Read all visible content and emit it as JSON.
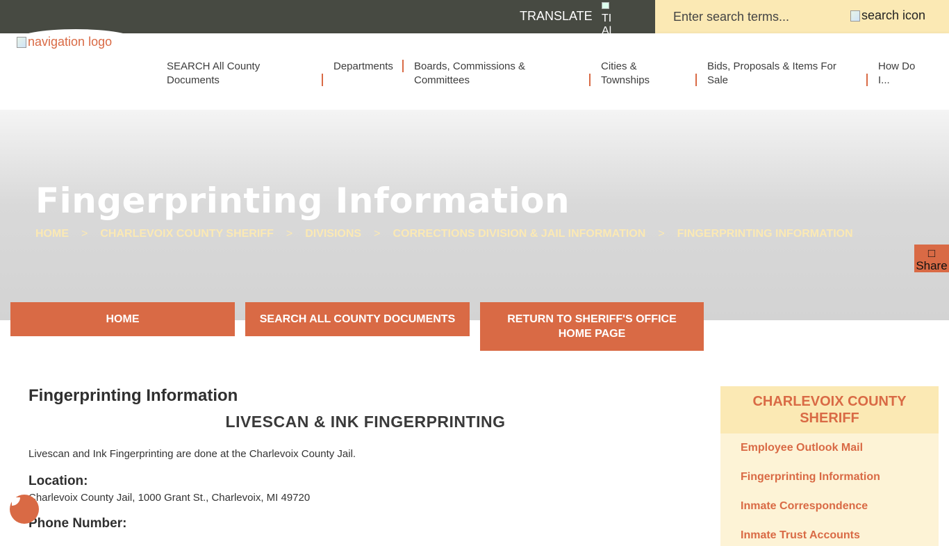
{
  "topbar": {
    "translate_label": "TRANSLATE",
    "translate_icon_alt": "TI Al"
  },
  "search": {
    "placeholder": "Enter search terms...",
    "button_alt": "search icon"
  },
  "nav": {
    "logo_alt": "navigation logo",
    "items": [
      {
        "line1": "SEARCH All County",
        "line2": "Documents"
      },
      {
        "line1": "Departments",
        "line2": ""
      },
      {
        "line1": "Boards, Commissions &",
        "line2": "Committees"
      },
      {
        "line1": "Cities &",
        "line2": "Townships"
      },
      {
        "line1": "Bids, Proposals & Items For",
        "line2": "Sale"
      },
      {
        "line1": "How Do",
        "line2": "I..."
      }
    ]
  },
  "hero": {
    "title": "Fingerprinting Information",
    "breadcrumbs": [
      "HOME",
      "CHARLEVOIX COUNTY SHERIFF",
      "DIVISIONS",
      "CORRECTIONS DIVISION & JAIL INFORMATION",
      "FINGERPRINTING INFORMATION"
    ],
    "breadcrumb_sep": ">"
  },
  "share": {
    "icon": "share-icon",
    "label": "Share"
  },
  "buttons": {
    "home": "HOME",
    "search_docs": "SEARCH ALL COUNTY DOCUMENTS",
    "return_line1": "RETURN TO SHERIFF'S OFFICE",
    "return_line2": "HOME PAGE"
  },
  "content": {
    "page_heading": "Fingerprinting Information",
    "section_heading": "LIVESCAN & INK FINGERPRINTING",
    "intro": "Livescan and Ink Fingerprinting are done at the Charlevoix County Jail.",
    "location_label": "Location:",
    "location_value": "Charlevoix County Jail, 1000 Grant St., Charlevoix, MI 49720",
    "phone_label": "Phone Number:"
  },
  "sidebar": {
    "heading_line1": "CHARLEVOIX COUNTY",
    "heading_line2": "SHERIFF",
    "links": [
      "Employee Outlook Mail",
      "Fingerprinting Information",
      "Inmate Correspondence",
      "Inmate Trust Accounts"
    ]
  },
  "colors": {
    "accent": "#d96a45",
    "topbar": "#474a42",
    "cream": "#fbe9b4",
    "sidebar_bg": "#fdf3d6"
  }
}
